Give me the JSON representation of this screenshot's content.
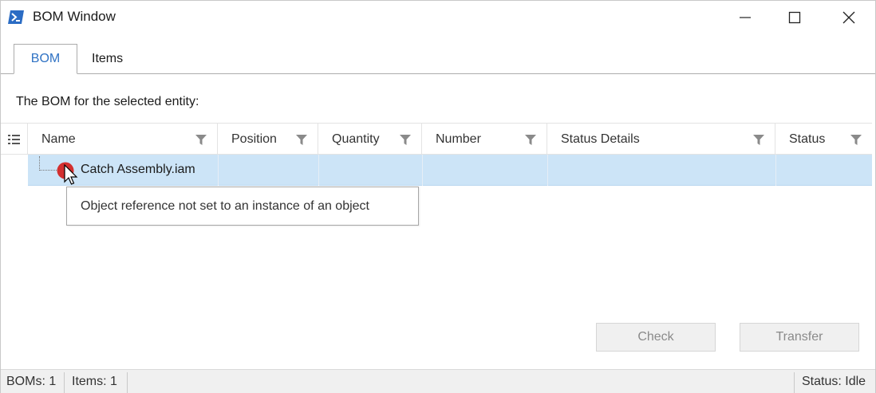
{
  "window": {
    "title": "BOM Window",
    "icon": "powershell-icon",
    "controls": {
      "minimize": "minimize-icon",
      "maximize": "maximize-icon",
      "close": "close-icon"
    }
  },
  "tabs": [
    {
      "label": "BOM",
      "active": true
    },
    {
      "label": "Items",
      "active": false
    }
  ],
  "caption": "The BOM for the selected entity:",
  "grid": {
    "columns": [
      "Name",
      "Position",
      "Quantity",
      "Number",
      "Status Details",
      "Status"
    ],
    "rows": [
      {
        "name": "Catch Assembly.iam",
        "position": "",
        "quantity": "",
        "number": "",
        "status_details": "",
        "status": "",
        "icon": "error-icon"
      }
    ]
  },
  "tooltip": "Object reference not set to an instance of an object",
  "buttons": {
    "check": "Check",
    "transfer": "Transfer"
  },
  "statusbar": {
    "boms": "BOMs: 1",
    "items": "Items: 1",
    "status": "Status: Idle"
  },
  "colors": {
    "accent": "#2f72c4",
    "selection": "#cce4f7",
    "error": "#d32f2f"
  }
}
